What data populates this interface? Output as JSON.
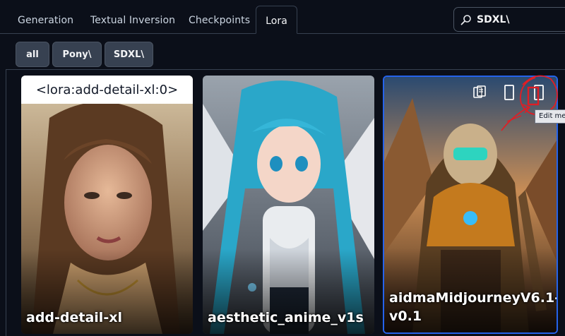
{
  "tabs": [
    {
      "label": "Generation"
    },
    {
      "label": "Textual Inversion"
    },
    {
      "label": "Checkpoints"
    },
    {
      "label": "Lora",
      "active": true
    }
  ],
  "search": {
    "value": "SDXL\\",
    "icon": "search-icon"
  },
  "filters": [
    {
      "label": "all"
    },
    {
      "label": "Pony\\"
    },
    {
      "label": "SDXL\\"
    }
  ],
  "cards": [
    {
      "name": "add-detail-xl",
      "prompt_overlay": "<lora:add-detail-xl:0>"
    },
    {
      "name": "aesthetic_anime_v1s"
    },
    {
      "name": "aidmaMidjourneyV6.1-v0.1"
    }
  ],
  "card_actions": {
    "icons": [
      "copy-path-icon",
      "replace-preview-icon",
      "edit-metadata-icon"
    ]
  },
  "tooltip": {
    "text": "Edit me"
  },
  "colors": {
    "background": "#0b0f19",
    "button": "#374151",
    "selected_border": "#2563eb",
    "annotation": "#e11d24"
  }
}
